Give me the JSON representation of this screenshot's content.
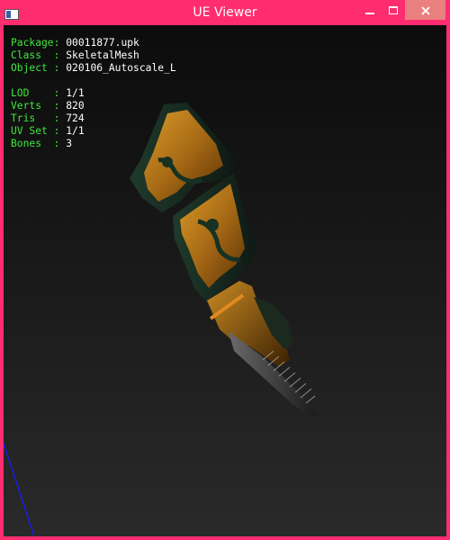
{
  "window": {
    "title": "UE Viewer",
    "accent": "#ff2d6f",
    "controls": {
      "minimize_glyph": "minimize-icon",
      "maximize_glyph": "maximize-icon",
      "close_glyph": "close-icon"
    }
  },
  "info": {
    "object": [
      {
        "key": "Package:",
        "value": "00011877.upk"
      },
      {
        "key": "Class  :",
        "value": "SkeletalMesh"
      },
      {
        "key": "Object :",
        "value": "020106_Autoscale_L"
      }
    ],
    "stats": [
      {
        "key": "LOD    :",
        "value": "1/1"
      },
      {
        "key": "Verts  :",
        "value": "820"
      },
      {
        "key": "Tris   :",
        "value": "724"
      },
      {
        "key": "UV Set :",
        "value": "1/1"
      },
      {
        "key": "Bones  :",
        "value": "3"
      }
    ]
  },
  "colors": {
    "label": "#3ee83e",
    "value": "#ffffff",
    "axis": "#1a1aff",
    "viewport_top": "#0c0c0c",
    "viewport_bottom": "#2a2a2a"
  }
}
